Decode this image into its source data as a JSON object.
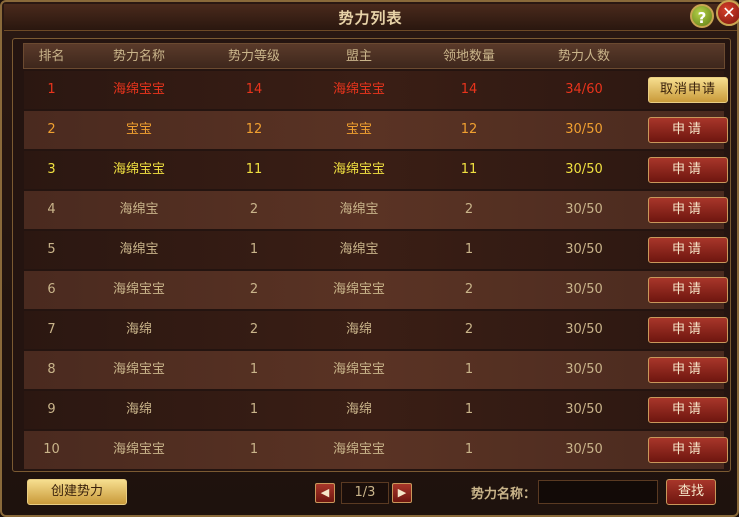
{
  "window": {
    "title": "势力列表",
    "help_label": "?",
    "close_label": "✕"
  },
  "table": {
    "headers": [
      "排名",
      "势力名称",
      "势力等级",
      "盟主",
      "领地数量",
      "势力人数"
    ],
    "rows": [
      {
        "rank": "1",
        "name": "海绵宝宝",
        "level": "14",
        "leader": "海绵宝宝",
        "land": "14",
        "people": "34/60",
        "action": "取消申请",
        "color": "#e8341c"
      },
      {
        "rank": "2",
        "name": "宝宝",
        "level": "12",
        "leader": "宝宝",
        "land": "12",
        "people": "30/50",
        "action": "申请",
        "color": "#f0a030"
      },
      {
        "rank": "3",
        "name": "海绵宝宝",
        "level": "11",
        "leader": "海绵宝宝",
        "land": "11",
        "people": "30/50",
        "action": "申请",
        "color": "#f0e040"
      },
      {
        "rank": "4",
        "name": "海绵宝",
        "level": "2",
        "leader": "海绵宝",
        "land": "2",
        "people": "30/50",
        "action": "申请",
        "color": "#c9b48a"
      },
      {
        "rank": "5",
        "name": "海绵宝",
        "level": "1",
        "leader": "海绵宝",
        "land": "1",
        "people": "30/50",
        "action": "申请",
        "color": "#c9b48a"
      },
      {
        "rank": "6",
        "name": "海绵宝宝",
        "level": "2",
        "leader": "海绵宝宝",
        "land": "2",
        "people": "30/50",
        "action": "申请",
        "color": "#c9b48a"
      },
      {
        "rank": "7",
        "name": "海绵",
        "level": "2",
        "leader": "海绵",
        "land": "2",
        "people": "30/50",
        "action": "申请",
        "color": "#c9b48a"
      },
      {
        "rank": "8",
        "name": "海绵宝宝",
        "level": "1",
        "leader": "海绵宝宝",
        "land": "1",
        "people": "30/50",
        "action": "申请",
        "color": "#c9b48a"
      },
      {
        "rank": "9",
        "name": "海绵",
        "level": "1",
        "leader": "海绵",
        "land": "1",
        "people": "30/50",
        "action": "申请",
        "color": "#c9b48a"
      },
      {
        "rank": "10",
        "name": "海绵宝宝",
        "level": "1",
        "leader": "海绵宝宝",
        "land": "1",
        "people": "30/50",
        "action": "申请",
        "color": "#c9b48a"
      }
    ]
  },
  "footer": {
    "create_label": "创建势力",
    "prev_icon": "◀",
    "next_icon": "▶",
    "page": "1/3",
    "search_label": "势力名称：",
    "search_value": "",
    "search_button": "查找"
  }
}
